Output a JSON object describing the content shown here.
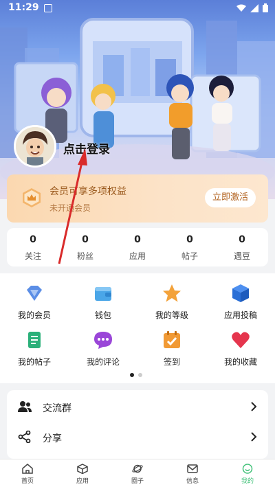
{
  "status_bar": {
    "time": "11:29"
  },
  "profile": {
    "login_prompt": "点击登录"
  },
  "membership": {
    "title": "会员可享多项权益",
    "subtitle": "未开通会员",
    "activate_label": "立即激活"
  },
  "stats": [
    {
      "value": "0",
      "label": "关注"
    },
    {
      "value": "0",
      "label": "粉丝"
    },
    {
      "value": "0",
      "label": "应用"
    },
    {
      "value": "0",
      "label": "帖子"
    },
    {
      "value": "0",
      "label": "遇豆"
    }
  ],
  "menu_grid": [
    {
      "label": "我的会员",
      "icon": "diamond-icon"
    },
    {
      "label": "钱包",
      "icon": "wallet-icon"
    },
    {
      "label": "我的等级",
      "icon": "star-icon"
    },
    {
      "label": "应用投稿",
      "icon": "cube-icon"
    },
    {
      "label": "我的帖子",
      "icon": "scroll-icon"
    },
    {
      "label": "我的评论",
      "icon": "comment-icon"
    },
    {
      "label": "签到",
      "icon": "calendar-check-icon"
    },
    {
      "label": "我的收藏",
      "icon": "heart-icon"
    }
  ],
  "list": [
    {
      "label": "交流群",
      "icon": "group-icon"
    },
    {
      "label": "分享",
      "icon": "share-icon"
    }
  ],
  "tabs": [
    {
      "label": "首页",
      "icon": "home-icon",
      "active": false
    },
    {
      "label": "应用",
      "icon": "apps-cube-icon",
      "active": false
    },
    {
      "label": "圈子",
      "icon": "planet-icon",
      "active": false
    },
    {
      "label": "信息",
      "icon": "mail-icon",
      "active": false
    },
    {
      "label": "我的",
      "icon": "smile-icon",
      "active": true
    }
  ],
  "colors": {
    "accent": "#43c27a",
    "vip_text": "#9b5a1e",
    "arrow": "#d92b2b"
  }
}
